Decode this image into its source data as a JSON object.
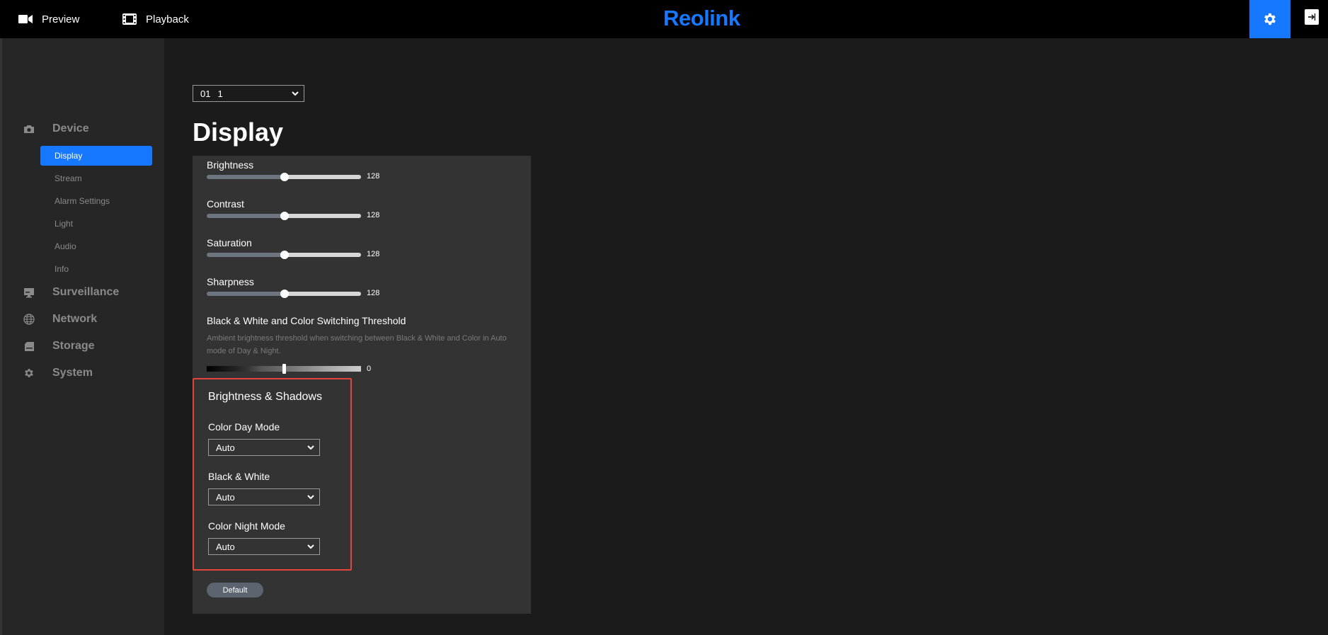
{
  "topbar": {
    "preview_label": "Preview",
    "playback_label": "Playback",
    "logo_text": "Reolink",
    "accent_color": "#1677ff"
  },
  "sidebar": {
    "groups": [
      {
        "label": "Device",
        "icon": "camera-icon"
      },
      {
        "label": "Surveillance",
        "icon": "monitor-icon"
      },
      {
        "label": "Network",
        "icon": "globe-icon"
      },
      {
        "label": "Storage",
        "icon": "storage-icon"
      },
      {
        "label": "System",
        "icon": "gear-icon"
      }
    ],
    "device_items": [
      "Display",
      "Stream",
      "Alarm Settings",
      "Light",
      "Audio",
      "Info"
    ],
    "active_item": "Display"
  },
  "channel": {
    "number": "01",
    "name": "1"
  },
  "page_title": "Display",
  "sliders": [
    {
      "label": "Brightness",
      "value": "128"
    },
    {
      "label": "Contrast",
      "value": "128"
    },
    {
      "label": "Saturation",
      "value": "128"
    },
    {
      "label": "Sharpness",
      "value": "128"
    }
  ],
  "threshold": {
    "label": "Black & White and Color Switching Threshold",
    "description": "Ambient brightness threshold when switching between Black & White and Color in Auto mode of Day & Night.",
    "value": "0"
  },
  "brightness_shadows": {
    "title": "Brightness & Shadows",
    "fields": [
      {
        "label": "Color Day Mode",
        "value": "Auto"
      },
      {
        "label": "Black & White",
        "value": "Auto"
      },
      {
        "label": "Color Night Mode",
        "value": "Auto"
      }
    ],
    "highlight_color": "#e2453b"
  },
  "default_button": "Default"
}
